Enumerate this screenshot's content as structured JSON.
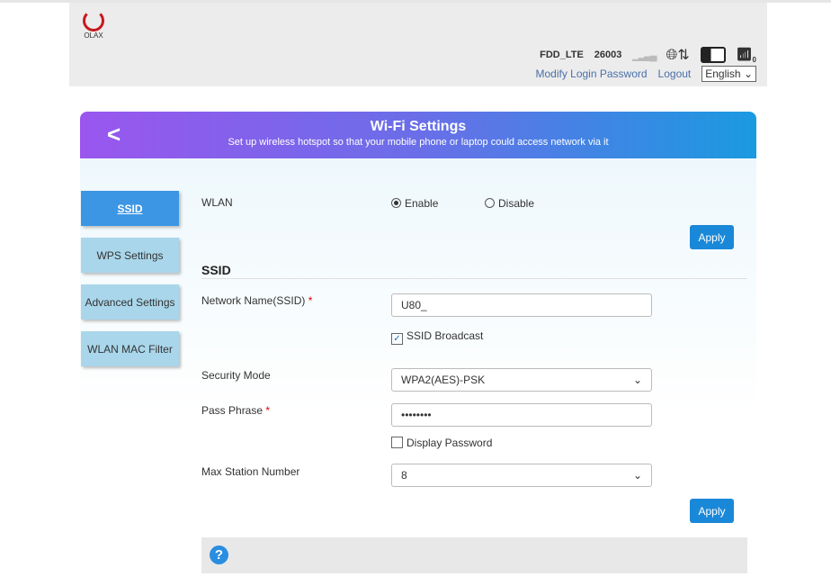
{
  "header": {
    "logo_text": "OLAX",
    "network_type": "FDD_LTE",
    "operator": "26003",
    "wifi_clients": "0",
    "modify_password": "Modify Login Password",
    "logout": "Logout",
    "language": "English"
  },
  "banner": {
    "title": "Wi-Fi Settings",
    "subtitle": "Set up wireless hotspot so that your mobile phone or laptop could access network via it"
  },
  "sidebar": {
    "items": [
      {
        "label": "SSID"
      },
      {
        "label": "WPS Settings"
      },
      {
        "label": "Advanced Settings"
      },
      {
        "label": "WLAN MAC Filter"
      }
    ]
  },
  "wlan": {
    "label": "WLAN",
    "enable": "Enable",
    "disable": "Disable",
    "apply": "Apply"
  },
  "ssid": {
    "heading": "SSID",
    "network_name_label": "Network Name(SSID)",
    "network_name": "U80_",
    "broadcast_label": "SSID Broadcast",
    "security_label": "Security Mode",
    "security": "WPA2(AES)-PSK",
    "pass_label": "Pass Phrase",
    "pass": "••••••••",
    "display_password": "Display Password",
    "max_label": "Max Station Number",
    "max": "8",
    "apply": "Apply",
    "required": "*"
  }
}
